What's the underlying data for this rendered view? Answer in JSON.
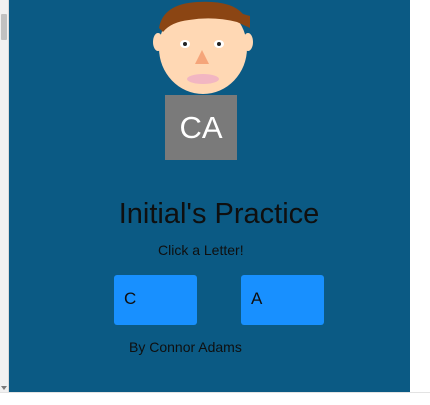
{
  "colors": {
    "background": "#0b5a84",
    "button": "#1890ff",
    "initials_box": "#7a7a7a",
    "hair": "#8b4513",
    "skin": "#ffd8b4"
  },
  "avatar": {
    "icon": "cartoon-face-icon"
  },
  "initials": "CA",
  "title": "Initial's Practice",
  "subtitle": "Click a Letter!",
  "buttons": [
    {
      "label": "C"
    },
    {
      "label": "A"
    }
  ],
  "byline": "By Connor Adams"
}
